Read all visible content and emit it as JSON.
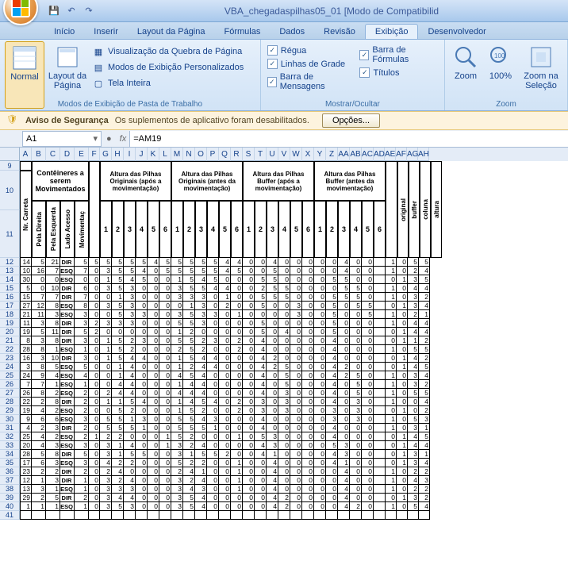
{
  "title": "VBA_chegadaspilhas05_01  [Modo de Compatibilid",
  "tabs": [
    "Início",
    "Inserir",
    "Layout da Página",
    "Fórmulas",
    "Dados",
    "Revisão",
    "Exibição",
    "Desenvolvedor"
  ],
  "active_tab": 6,
  "ribbon": {
    "views": {
      "normal": "Normal",
      "layout": "Layout da Página",
      "group": "Modos de Exibição de Pasta de Trabalho",
      "quebra": "Visualização da Quebra de Página",
      "pers": "Modos de Exibição Personalizados",
      "tela": "Tela Inteira"
    },
    "show": {
      "group": "Mostrar/Ocultar",
      "regua": "Régua",
      "linhas": "Linhas de Grade",
      "msgbar": "Barra de Mensagens",
      "formulas": "Barra de Fórmulas",
      "titulos": "Títulos"
    },
    "zoom": {
      "group": "Zoom",
      "zoom": "Zoom",
      "z100": "100%",
      "zsel": "Zoom na Seleção"
    }
  },
  "security": {
    "title": "Aviso de Segurança",
    "msg": "Os suplementos de aplicativo foram desabilitados.",
    "btn": "Opções..."
  },
  "namebox": "A1",
  "formula": "=AM19",
  "col_letters": [
    "A",
    "B",
    "C",
    "D",
    "E",
    "F",
    "G",
    "H",
    "I",
    "J",
    "K",
    "L",
    "M",
    "N",
    "O",
    "P",
    "Q",
    "R",
    "S",
    "T",
    "U",
    "V",
    "W",
    "X",
    "Y",
    "Z",
    "AA",
    "AB",
    "AC",
    "AD",
    "AE",
    "AF",
    "AG",
    "AH"
  ],
  "row_start": 9,
  "row_end": 41,
  "headers": {
    "nr": "Nr. Carreta",
    "cont": "Contêineres a serem Movimentados",
    "cont_sub": [
      "Pela Direita",
      "Pela Esquerda",
      "Lado Acesso",
      "Movimentaç"
    ],
    "orig_apos": "Altura das Pilhas Originais (após a movimentação)",
    "orig_antes": "Altura das Pilhas Originais          (antes da movimentação)",
    "buf_apos": "Altura das Pilhas Buffer          (após a movimentação)",
    "buf_antes": "Altura das Pilhas Buffer (antes da movimentação)",
    "nums": [
      "1",
      "2",
      "3",
      "4",
      "5",
      "6"
    ],
    "end": [
      "original",
      "buffer",
      "coluna",
      "altura"
    ]
  },
  "rows": [
    {
      "r": 12,
      "d": [
        14,
        5,
        21,
        "DIR",
        5,
        5,
        5,
        5,
        5,
        5,
        4,
        5,
        5,
        5,
        5,
        5,
        4,
        4,
        0,
        0,
        4,
        0,
        0,
        0,
        0,
        0,
        4,
        0,
        0,
        "",
        1,
        0,
        5,
        5
      ]
    },
    {
      "r": 13,
      "d": [
        10,
        16,
        7,
        "ESQ",
        7,
        0,
        3,
        5,
        5,
        4,
        0,
        5,
        5,
        5,
        5,
        5,
        4,
        5,
        0,
        0,
        5,
        0,
        0,
        0,
        0,
        0,
        4,
        0,
        0,
        "",
        1,
        0,
        2,
        4
      ]
    },
    {
      "r": 14,
      "d": [
        30,
        0,
        0,
        "ESQ",
        0,
        0,
        1,
        5,
        4,
        5,
        0,
        0,
        1,
        5,
        4,
        5,
        0,
        0,
        0,
        5,
        5,
        0,
        0,
        0,
        0,
        5,
        5,
        0,
        0,
        "",
        0,
        1,
        3,
        5
      ]
    },
    {
      "r": 15,
      "d": [
        5,
        0,
        10,
        "DIR",
        6,
        0,
        3,
        5,
        3,
        0,
        0,
        0,
        3,
        5,
        5,
        4,
        4,
        0,
        0,
        2,
        5,
        5,
        0,
        0,
        0,
        0,
        5,
        5,
        0,
        "",
        1,
        0,
        4,
        4
      ]
    },
    {
      "r": 16,
      "d": [
        15,
        7,
        7,
        "DIR",
        7,
        0,
        0,
        1,
        3,
        0,
        0,
        0,
        3,
        3,
        3,
        0,
        1,
        0,
        0,
        5,
        5,
        5,
        0,
        0,
        0,
        5,
        5,
        5,
        0,
        "",
        1,
        0,
        3,
        2
      ]
    },
    {
      "r": 17,
      "d": [
        27,
        12,
        8,
        "ESQ",
        8,
        0,
        3,
        5,
        3,
        0,
        0,
        0,
        0,
        1,
        3,
        0,
        2,
        0,
        0,
        5,
        0,
        0,
        3,
        0,
        0,
        5,
        0,
        5,
        5,
        "",
        0,
        1,
        3,
        4
      ]
    },
    {
      "r": 18,
      "d": [
        21,
        11,
        3,
        "ESQ",
        3,
        0,
        0,
        5,
        3,
        3,
        0,
        0,
        3,
        5,
        3,
        3,
        0,
        1,
        0,
        0,
        0,
        0,
        3,
        0,
        0,
        5,
        0,
        0,
        5,
        "",
        1,
        0,
        2,
        1
      ]
    },
    {
      "r": 19,
      "d": [
        11,
        3,
        8,
        "DIR",
        3,
        2,
        3,
        3,
        3,
        0,
        0,
        0,
        5,
        5,
        3,
        0,
        0,
        0,
        0,
        5,
        0,
        0,
        0,
        0,
        0,
        5,
        0,
        0,
        0,
        "",
        1,
        0,
        4,
        4
      ]
    },
    {
      "r": 20,
      "d": [
        19,
        5,
        11,
        "DIR",
        5,
        2,
        0,
        0,
        0,
        0,
        0,
        0,
        1,
        2,
        0,
        0,
        0,
        0,
        0,
        5,
        0,
        4,
        0,
        0,
        0,
        5,
        0,
        0,
        0,
        "",
        0,
        1,
        4,
        4
      ]
    },
    {
      "r": 21,
      "d": [
        8,
        3,
        8,
        "DIR",
        3,
        0,
        1,
        5,
        2,
        3,
        0,
        0,
        5,
        5,
        2,
        3,
        0,
        2,
        0,
        4,
        0,
        0,
        0,
        0,
        0,
        4,
        0,
        0,
        0,
        "",
        0,
        1,
        1,
        2
      ]
    },
    {
      "r": 22,
      "d": [
        28,
        8,
        1,
        "ESQ",
        1,
        0,
        1,
        5,
        2,
        0,
        0,
        0,
        2,
        5,
        2,
        0,
        0,
        2,
        0,
        4,
        0,
        0,
        0,
        0,
        0,
        4,
        0,
        0,
        0,
        "",
        1,
        0,
        5,
        5
      ]
    },
    {
      "r": 23,
      "d": [
        16,
        3,
        10,
        "DIR",
        3,
        0,
        1,
        5,
        4,
        4,
        0,
        0,
        1,
        5,
        4,
        4,
        0,
        0,
        0,
        4,
        2,
        0,
        0,
        0,
        0,
        4,
        0,
        0,
        0,
        "",
        0,
        1,
        4,
        2
      ]
    },
    {
      "r": 24,
      "d": [
        3,
        8,
        5,
        "ESQ",
        5,
        0,
        0,
        1,
        4,
        0,
        0,
        0,
        1,
        2,
        4,
        4,
        0,
        0,
        0,
        4,
        2,
        5,
        0,
        0,
        0,
        4,
        2,
        0,
        0,
        "",
        0,
        1,
        4,
        5
      ]
    },
    {
      "r": 25,
      "d": [
        24,
        9,
        4,
        "ESQ",
        4,
        0,
        0,
        1,
        4,
        0,
        0,
        0,
        4,
        5,
        4,
        0,
        0,
        0,
        0,
        4,
        0,
        5,
        0,
        0,
        0,
        4,
        2,
        5,
        0,
        "",
        1,
        0,
        3,
        4
      ]
    },
    {
      "r": 26,
      "d": [
        7,
        7,
        1,
        "ESQ",
        1,
        0,
        0,
        4,
        4,
        0,
        0,
        0,
        1,
        4,
        4,
        0,
        0,
        0,
        0,
        4,
        0,
        5,
        0,
        0,
        0,
        4,
        0,
        5,
        0,
        "",
        1,
        0,
        3,
        2
      ]
    },
    {
      "r": 27,
      "d": [
        26,
        8,
        2,
        "ESQ",
        2,
        0,
        2,
        4,
        4,
        0,
        0,
        0,
        4,
        4,
        4,
        0,
        0,
        0,
        0,
        4,
        0,
        3,
        0,
        0,
        0,
        4,
        0,
        5,
        0,
        "",
        1,
        0,
        5,
        5
      ]
    },
    {
      "r": 28,
      "d": [
        22,
        2,
        8,
        "DIR",
        2,
        0,
        1,
        1,
        5,
        4,
        0,
        0,
        1,
        4,
        5,
        4,
        0,
        2,
        0,
        3,
        0,
        3,
        0,
        0,
        0,
        4,
        0,
        3,
        0,
        "",
        1,
        0,
        0,
        4
      ]
    },
    {
      "r": 29,
      "d": [
        19,
        4,
        2,
        "ESQ",
        2,
        0,
        0,
        5,
        2,
        0,
        0,
        0,
        1,
        5,
        2,
        0,
        0,
        2,
        0,
        3,
        0,
        3,
        0,
        0,
        0,
        3,
        0,
        3,
        0,
        "",
        0,
        1,
        0,
        2
      ]
    },
    {
      "r": 30,
      "d": [
        9,
        6,
        6,
        "ESQ",
        3,
        0,
        5,
        5,
        1,
        3,
        0,
        0,
        5,
        5,
        4,
        3,
        0,
        0,
        0,
        4,
        0,
        0,
        0,
        0,
        0,
        3,
        0,
        3,
        0,
        "",
        1,
        0,
        5,
        3
      ]
    },
    {
      "r": 31,
      "d": [
        4,
        2,
        3,
        "DIR",
        2,
        0,
        5,
        5,
        5,
        1,
        0,
        0,
        5,
        5,
        5,
        1,
        0,
        0,
        0,
        4,
        0,
        0,
        0,
        0,
        0,
        4,
        0,
        0,
        0,
        "",
        1,
        0,
        3,
        1
      ]
    },
    {
      "r": 32,
      "d": [
        25,
        4,
        2,
        "ESQ",
        2,
        1,
        2,
        2,
        0,
        0,
        0,
        1,
        5,
        2,
        0,
        0,
        0,
        1,
        0,
        5,
        3,
        0,
        0,
        0,
        0,
        4,
        0,
        0,
        0,
        "",
        0,
        1,
        4,
        5
      ]
    },
    {
      "r": 33,
      "d": [
        20,
        4,
        3,
        "ESQ",
        3,
        0,
        3,
        1,
        4,
        0,
        0,
        1,
        3,
        2,
        4,
        0,
        0,
        0,
        0,
        4,
        3,
        0,
        0,
        0,
        0,
        5,
        3,
        0,
        0,
        "",
        0,
        1,
        4,
        4
      ]
    },
    {
      "r": 34,
      "d": [
        28,
        5,
        8,
        "DIR",
        5,
        0,
        3,
        1,
        5,
        5,
        0,
        0,
        3,
        1,
        5,
        5,
        2,
        0,
        0,
        4,
        1,
        0,
        0,
        0,
        0,
        4,
        3,
        0,
        0,
        "",
        0,
        1,
        3,
        1
      ]
    },
    {
      "r": 35,
      "d": [
        17,
        6,
        3,
        "ESQ",
        3,
        0,
        4,
        2,
        2,
        0,
        0,
        0,
        5,
        2,
        2,
        0,
        0,
        1,
        0,
        0,
        4,
        0,
        0,
        0,
        0,
        4,
        1,
        0,
        0,
        "",
        0,
        1,
        3,
        4
      ]
    },
    {
      "r": 36,
      "d": [
        23,
        2,
        2,
        "DIR",
        2,
        0,
        2,
        4,
        0,
        0,
        0,
        0,
        2,
        4,
        1,
        0,
        0,
        1,
        0,
        0,
        4,
        0,
        0,
        0,
        0,
        0,
        4,
        0,
        0,
        "",
        1,
        0,
        2,
        2
      ]
    },
    {
      "r": 37,
      "d": [
        12,
        1,
        3,
        "DIR",
        1,
        0,
        3,
        2,
        4,
        0,
        0,
        0,
        3,
        2,
        4,
        0,
        0,
        1,
        0,
        0,
        4,
        0,
        0,
        0,
        0,
        0,
        4,
        0,
        0,
        "",
        1,
        0,
        4,
        3
      ]
    },
    {
      "r": 38,
      "d": [
        13,
        3,
        1,
        "ESQ",
        1,
        0,
        3,
        3,
        3,
        0,
        0,
        0,
        3,
        4,
        3,
        0,
        0,
        1,
        0,
        0,
        4,
        0,
        0,
        0,
        0,
        0,
        4,
        0,
        0,
        "",
        1,
        0,
        2,
        2
      ]
    },
    {
      "r": 39,
      "d": [
        29,
        2,
        5,
        "DIR",
        2,
        0,
        3,
        4,
        4,
        0,
        0,
        0,
        3,
        5,
        4,
        0,
        0,
        0,
        0,
        0,
        4,
        2,
        0,
        0,
        0,
        0,
        4,
        0,
        0,
        "",
        0,
        1,
        3,
        2
      ]
    },
    {
      "r": 40,
      "d": [
        1,
        1,
        1,
        "ESQ",
        1,
        0,
        3,
        5,
        3,
        0,
        0,
        0,
        3,
        5,
        4,
        0,
        0,
        0,
        0,
        0,
        4,
        2,
        0,
        0,
        0,
        0,
        4,
        2,
        0,
        "",
        1,
        0,
        5,
        4
      ]
    },
    {
      "r": 41,
      "d": [
        "",
        "",
        "",
        "",
        "",
        "",
        "",
        "",
        "",
        "",
        "",
        "",
        "",
        "",
        "",
        "",
        "",
        "",
        "",
        "",
        "",
        "",
        "",
        "",
        "",
        "",
        "",
        "",
        "",
        "",
        "",
        "",
        "",
        ""
      ]
    }
  ]
}
